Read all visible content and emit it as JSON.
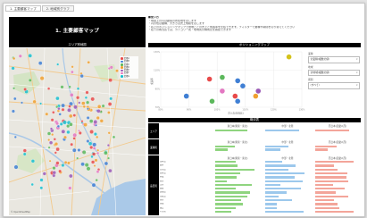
{
  "tabs": [
    {
      "label": "1. 主要顧客マップ"
    },
    {
      "label": "2. 地域別グラフ"
    }
  ],
  "title": "1. 主要顧客マップ",
  "notes": {
    "heading": "■使い方",
    "lines": [
      "・地図上の円は顧客の所在地を表します",
      "・円の色は業種、大きさは売上規模を表します",
      "・右上のポジショニングマップで地域ごとの売上と成長率を比較できます。フィルターで業種や期間を切り替えてください",
      "・右下の概況表では、カテゴリー別・地域別の構成比を確認できます"
    ]
  },
  "map": {
    "header": "エリア別地図",
    "legend": [
      {
        "label": "業種A",
        "color": "#e84a4a"
      },
      {
        "label": "業種B",
        "color": "#3f7fd4"
      },
      {
        "label": "業種C",
        "color": "#5cb85c"
      },
      {
        "label": "業種D",
        "color": "#f0a030"
      },
      {
        "label": "業種E",
        "color": "#9b59b6"
      },
      {
        "label": "業種F",
        "color": "#e377c2"
      },
      {
        "label": "業種G",
        "color": "#17becf"
      }
    ],
    "credit": "© OpenStreetMap"
  },
  "positioning": {
    "header": "ポジショニングマップ",
    "xlabel": "売上高(前年比)",
    "ylabel": "成長率",
    "x_ticks": [
      "80%",
      "90%",
      "100%",
      "110%",
      "120%",
      "130%"
    ],
    "y_ticks": [
      "130%",
      "110%",
      "90%",
      "70%"
    ],
    "filters": [
      {
        "label": "業種",
        "value": "全業種(複数の値)"
      },
      {
        "label": "地域",
        "value": "全地域(複数の値)"
      },
      {
        "label": "期間",
        "value": "(すべて)"
      }
    ]
  },
  "chart_data": {
    "type": "scatter",
    "x": [
      0.99,
      1.04,
      1.1,
      1.12,
      1.04,
      1.18,
      1.17,
      1.09,
      1.1,
      0.9,
      1.0,
      1.3
    ],
    "y": [
      1.08,
      1.1,
      1.06,
      1.0,
      0.94,
      0.94,
      0.88,
      0.88,
      0.82,
      0.88,
      0.82,
      1.34
    ],
    "colors": [
      "#e84a4a",
      "#5cb85c",
      "#3f7fd4",
      "#3f7fd4",
      "#e377c2",
      "#9b59b6",
      "#f0a030",
      "#e84a4a",
      "#3f7fd4",
      "#3f7fd4",
      "#5cb85c",
      "#d4c21a"
    ],
    "xlim": [
      0.8,
      1.35
    ],
    "ylim": [
      0.75,
      1.4
    ]
  },
  "table": {
    "header": "概況表",
    "row_labels": [
      "エリア",
      "業種別",
      "品目別"
    ],
    "col_headers": [
      "東日本(関東・東北)",
      "中部・北陸",
      "西日本(近畿以西)"
    ],
    "categories": [
      "食料品",
      "飲料",
      "日用品",
      "衣料品",
      "家電",
      "家具",
      "文具",
      "雑貨",
      "医薬品",
      "化粧品",
      "玩具",
      "書籍",
      "園芸",
      "その他"
    ],
    "col_colors": [
      "#8fd47f",
      "#9cc8ec",
      "#f3a59a"
    ]
  }
}
